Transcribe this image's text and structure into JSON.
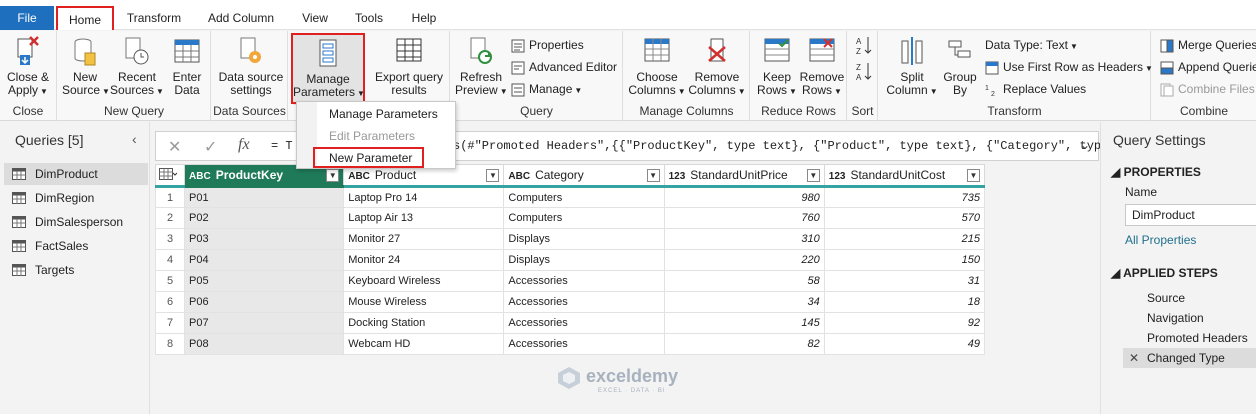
{
  "tabs": [
    "File",
    "Home",
    "Transform",
    "Add Column",
    "View",
    "Tools",
    "Help"
  ],
  "ribbon": {
    "close_apply": [
      "Close &",
      "Apply"
    ],
    "new_source": [
      "New",
      "Source"
    ],
    "recent_sources": [
      "Recent",
      "Sources"
    ],
    "enter_data": [
      "Enter",
      "Data"
    ],
    "data_source_settings": [
      "Data source",
      "settings"
    ],
    "manage_parameters": [
      "Manage",
      "Parameters"
    ],
    "export_query": [
      "Export query",
      "results"
    ],
    "refresh_preview": [
      "Refresh",
      "Preview"
    ],
    "properties": "Properties",
    "advanced_editor": "Advanced Editor",
    "manage": "Manage",
    "choose_columns": [
      "Choose",
      "Columns"
    ],
    "remove_columns": [
      "Remove",
      "Columns"
    ],
    "keep_rows": [
      "Keep",
      "Rows"
    ],
    "remove_rows": [
      "Remove",
      "Rows"
    ],
    "split_column": [
      "Split",
      "Column"
    ],
    "group_by": [
      "Group",
      "By"
    ],
    "data_type": "Data Type: Text",
    "use_first_row": "Use First Row as Headers",
    "replace_values": "Replace Values",
    "merge_queries": "Merge Queries",
    "append_queries": "Append Queries",
    "combine_files": "Combine Files",
    "groups": [
      "Close",
      "New Query",
      "Data Sources",
      "Query",
      "Manage Columns",
      "Reduce Rows",
      "Sort",
      "Transform",
      "Combine"
    ]
  },
  "dropdown": [
    "Manage Parameters",
    "Edit Parameters",
    "New Parameter"
  ],
  "queries": {
    "title": "Queries [5]",
    "items": [
      "DimProduct",
      "DimRegion",
      "DimSalesperson",
      "FactSales",
      "Targets"
    ],
    "selected": "DimProduct"
  },
  "formula": {
    "prefix": "= T",
    "text": "s(#\"Promoted Headers\",{{\"ProductKey\", type text}, {\"Product\", type text}, {\"Category\", type"
  },
  "table": {
    "columns": [
      {
        "type": "ABC",
        "name": "ProductKey"
      },
      {
        "type": "ABC",
        "name": "Product"
      },
      {
        "type": "ABC",
        "name": "Category"
      },
      {
        "type": "123",
        "name": "StandardUnitPrice"
      },
      {
        "type": "123",
        "name": "StandardUnitCost"
      }
    ],
    "rows": [
      [
        "1",
        "P01",
        "Laptop Pro 14",
        "Computers",
        "980",
        "735"
      ],
      [
        "2",
        "P02",
        "Laptop Air 13",
        "Computers",
        "760",
        "570"
      ],
      [
        "3",
        "P03",
        "Monitor 27",
        "Displays",
        "310",
        "215"
      ],
      [
        "4",
        "P04",
        "Monitor 24",
        "Displays",
        "220",
        "150"
      ],
      [
        "5",
        "P05",
        "Keyboard Wireless",
        "Accessories",
        "58",
        "31"
      ],
      [
        "6",
        "P06",
        "Mouse Wireless",
        "Accessories",
        "34",
        "18"
      ],
      [
        "7",
        "P07",
        "Docking Station",
        "Accessories",
        "145",
        "92"
      ],
      [
        "8",
        "P08",
        "Webcam HD",
        "Accessories",
        "82",
        "49"
      ]
    ]
  },
  "settings": {
    "title": "Query Settings",
    "properties": "PROPERTIES",
    "name_label": "Name",
    "name_value": "DimProduct",
    "all_properties": "All Properties",
    "applied_steps": "APPLIED STEPS",
    "steps": [
      "Source",
      "Navigation",
      "Promoted Headers",
      "Changed Type"
    ]
  },
  "watermark": {
    "brand": "exceldemy",
    "tagline": "EXCEL · DATA · BI"
  },
  "colors": {
    "file_tab": "#1f6fbf",
    "highlight": "#e02020",
    "key_column": "#1f7a5a",
    "header_accent": "#36a3a3"
  }
}
